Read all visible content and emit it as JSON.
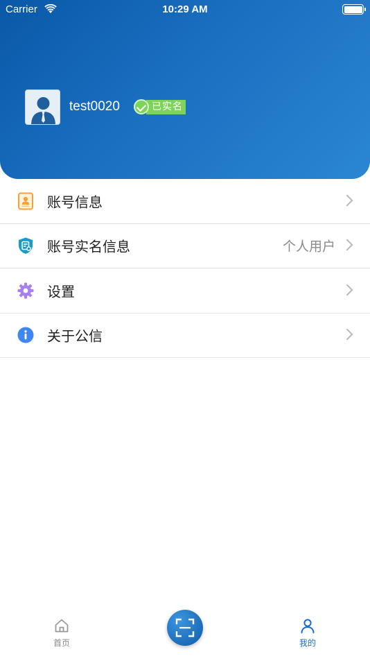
{
  "status_bar": {
    "carrier": "Carrier",
    "time": "10:29 AM"
  },
  "profile": {
    "username": "test0020",
    "verified_label": "已实名"
  },
  "menu": {
    "items": [
      {
        "label": "账号信息",
        "value": "",
        "icon": "id-card-icon"
      },
      {
        "label": "账号实名信息",
        "value": "个人用户",
        "icon": "shield-icon"
      },
      {
        "label": "设置",
        "value": "",
        "icon": "gear-icon"
      },
      {
        "label": "关于公信",
        "value": "",
        "icon": "info-icon"
      }
    ]
  },
  "tab_bar": {
    "home_label": "首页",
    "mine_label": "我的",
    "scan_icon": "scan-icon"
  },
  "colors": {
    "header_start": "#0a58a8",
    "header_end": "#2b86d3",
    "verified_green": "#7ed35a",
    "active_tab": "#1b6fc7"
  }
}
